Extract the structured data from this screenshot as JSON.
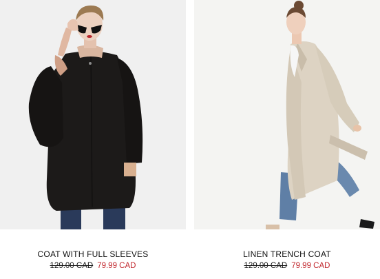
{
  "products": [
    {
      "name": "COAT WITH FULL SLEEVES",
      "old_price": "129.00 CAD",
      "sale_price": "79.99 CAD",
      "image_alt": "black-coat-photo"
    },
    {
      "name": "LINEN TRENCH COAT",
      "old_price": "129.00 CAD",
      "sale_price": "79.99 CAD",
      "image_alt": "linen-trench-coat-photo"
    }
  ],
  "colors": {
    "sale_red": "#c1272d",
    "photo_bg_1": "#f2f2f2",
    "photo_bg_2": "#f4f4f2"
  }
}
